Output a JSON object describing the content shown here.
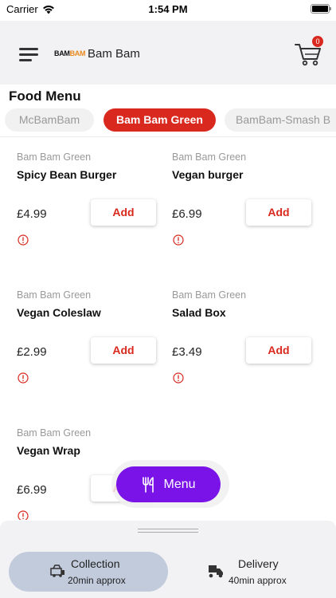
{
  "status_bar": {
    "carrier": "Carrier",
    "time": "1:54 PM"
  },
  "header": {
    "logo_part1": "BAM",
    "logo_part2": "BAM",
    "store_name": "Bam Bam",
    "cart_count": "0"
  },
  "menu": {
    "title": "Food Menu",
    "tabs": [
      {
        "label": "McBamBam",
        "active": false
      },
      {
        "label": "Bam Bam Green",
        "active": true
      },
      {
        "label": "BamBam-Smash B",
        "active": false
      }
    ]
  },
  "products": [
    {
      "category": "Bam Bam Green",
      "name": "Spicy Bean Burger",
      "price": "£4.99",
      "add_label": "Add"
    },
    {
      "category": "Bam Bam Green",
      "name": "Vegan burger",
      "price": "£6.99",
      "add_label": "Add"
    },
    {
      "category": "Bam Bam Green",
      "name": "Vegan Coleslaw",
      "price": "£2.99",
      "add_label": "Add"
    },
    {
      "category": "Bam Bam Green",
      "name": "Salad Box",
      "price": "£3.49",
      "add_label": "Add"
    },
    {
      "category": "Bam Bam Green",
      "name": "Vegan Wrap",
      "price": "£6.99",
      "add_label": "Add"
    }
  ],
  "fab": {
    "label": "Menu",
    "icon": "fork-knife-icon"
  },
  "order_mode": {
    "collection": {
      "title": "Collection",
      "subtitle": "20min approx",
      "selected": true
    },
    "delivery": {
      "title": "Delivery",
      "subtitle": "40min approx",
      "selected": false
    }
  },
  "colors": {
    "accent_red": "#d9281e",
    "fab_purple": "#7a13e8",
    "selected_pill": "#c2cbdc",
    "header_bg": "#f2f2f4"
  }
}
